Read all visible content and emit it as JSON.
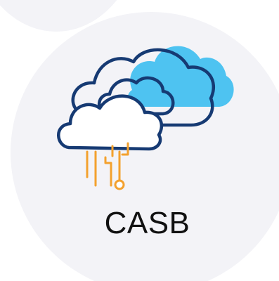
{
  "label": "CASB",
  "icon": "cloud-circuit-icon",
  "colors": {
    "disc": "#f3f3f7",
    "cloud_fill_back": "#4ec3f1",
    "cloud_outline": "#163a73",
    "cloud_fill_front": "#ffffff",
    "circuit": "#f3a12e"
  }
}
